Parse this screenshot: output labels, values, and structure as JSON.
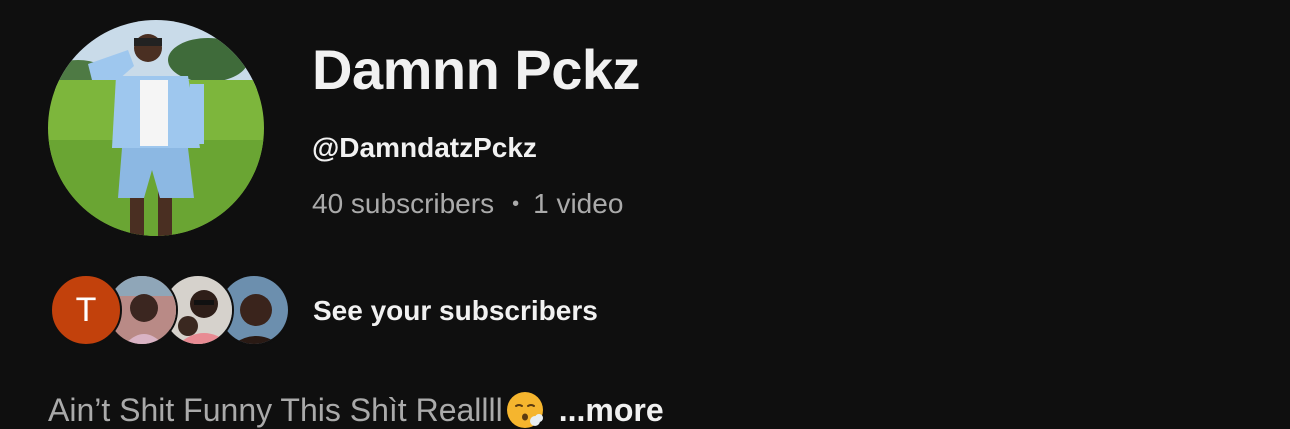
{
  "channel": {
    "name": "Damnn Pckz",
    "handle": "@DamndatzPckz",
    "subscribers_text": "40 subscribers",
    "separator": "•",
    "videos_text": "1 video"
  },
  "subscribers": {
    "link_label": "See your subscribers",
    "first_avatar_letter": "T",
    "first_avatar_color": "#c2410c"
  },
  "description": {
    "text": "Ain’t Shit Funny This Shìt Reallll",
    "emoji": "face-exhaling-icon",
    "more_label": "...more"
  },
  "colors": {
    "background": "#0f0f0f",
    "primary_text": "#f1f1f1",
    "secondary_text": "#aaaaaa"
  }
}
